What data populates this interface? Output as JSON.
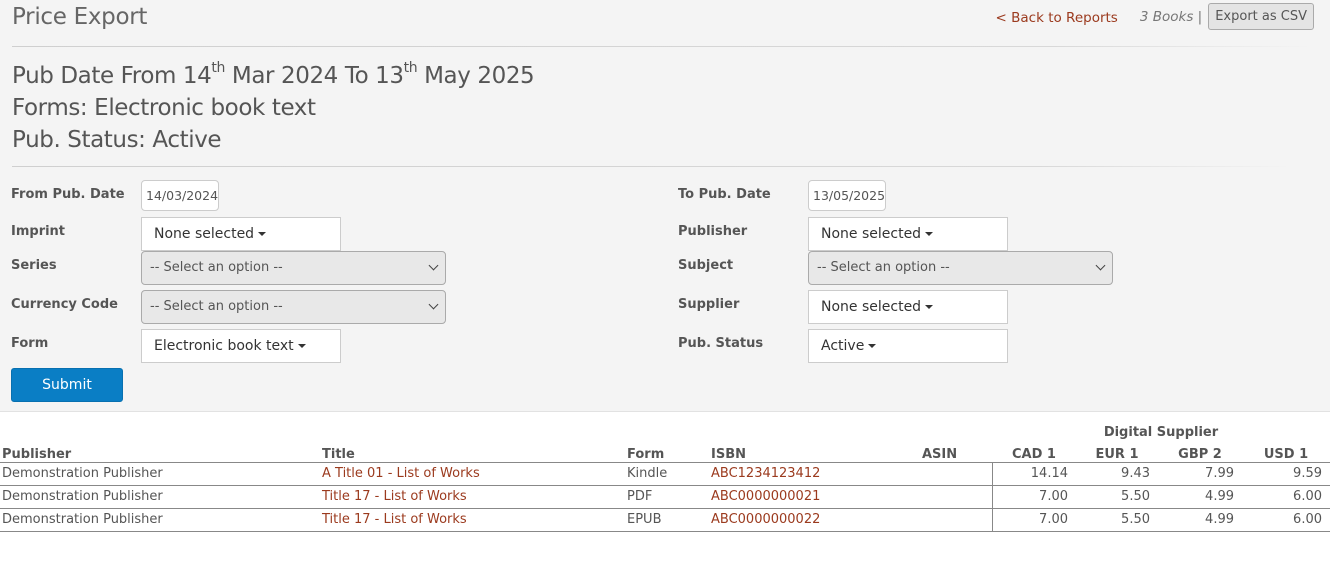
{
  "page": {
    "title": "Price Export",
    "back_link": "< Back to Reports",
    "books_count": "3 Books |",
    "export_label": "Export as CSV"
  },
  "summary": {
    "line1_prefix": "Pub Date From 14",
    "line1_sup1": "th",
    "line1_mid": " Mar 2024 To 13",
    "line1_sup2": "th",
    "line1_suffix": " May 2025",
    "line2": "Forms: Electronic book text",
    "line3": "Pub. Status: Active"
  },
  "filters": {
    "from_pub_date": {
      "label": "From Pub. Date",
      "value": "14/03/2024"
    },
    "to_pub_date": {
      "label": "To Pub. Date",
      "value": "13/05/2025"
    },
    "imprint": {
      "label": "Imprint",
      "value": "None selected"
    },
    "publisher": {
      "label": "Publisher",
      "value": "None selected"
    },
    "series": {
      "label": "Series",
      "value": "-- Select an option --"
    },
    "subject": {
      "label": "Subject",
      "value": "-- Select an option --"
    },
    "currency_code": {
      "label": "Currency Code",
      "value": "-- Select an option --"
    },
    "supplier": {
      "label": "Supplier",
      "value": "None selected"
    },
    "form": {
      "label": "Form",
      "value": "Electronic book text"
    },
    "pub_status": {
      "label": "Pub. Status",
      "value": "Active"
    },
    "submit_label": "Submit"
  },
  "table": {
    "group_header": "Digital Supplier",
    "columns": [
      "Publisher",
      "Title",
      "Form",
      "ISBN",
      "ASIN",
      "CAD 1",
      "EUR 1",
      "GBP 2",
      "USD 1"
    ],
    "rows": [
      [
        "Demonstration Publisher",
        "A Title 01 - List of Works",
        "Kindle",
        "ABC1234123412",
        "",
        "14.14",
        "9.43",
        "7.99",
        "9.59"
      ],
      [
        "Demonstration Publisher",
        "Title 17 - List of Works",
        "PDF",
        "ABC0000000021",
        "",
        "7.00",
        "5.50",
        "4.99",
        "6.00"
      ],
      [
        "Demonstration Publisher",
        "Title 17 - List of Works",
        "EPUB",
        "ABC0000000022",
        "",
        "7.00",
        "5.50",
        "4.99",
        "6.00"
      ]
    ]
  },
  "colors": {
    "link": "#9b3a1e",
    "primary_button": "#0a7ec5",
    "panel_background": "#f4f4f4"
  }
}
